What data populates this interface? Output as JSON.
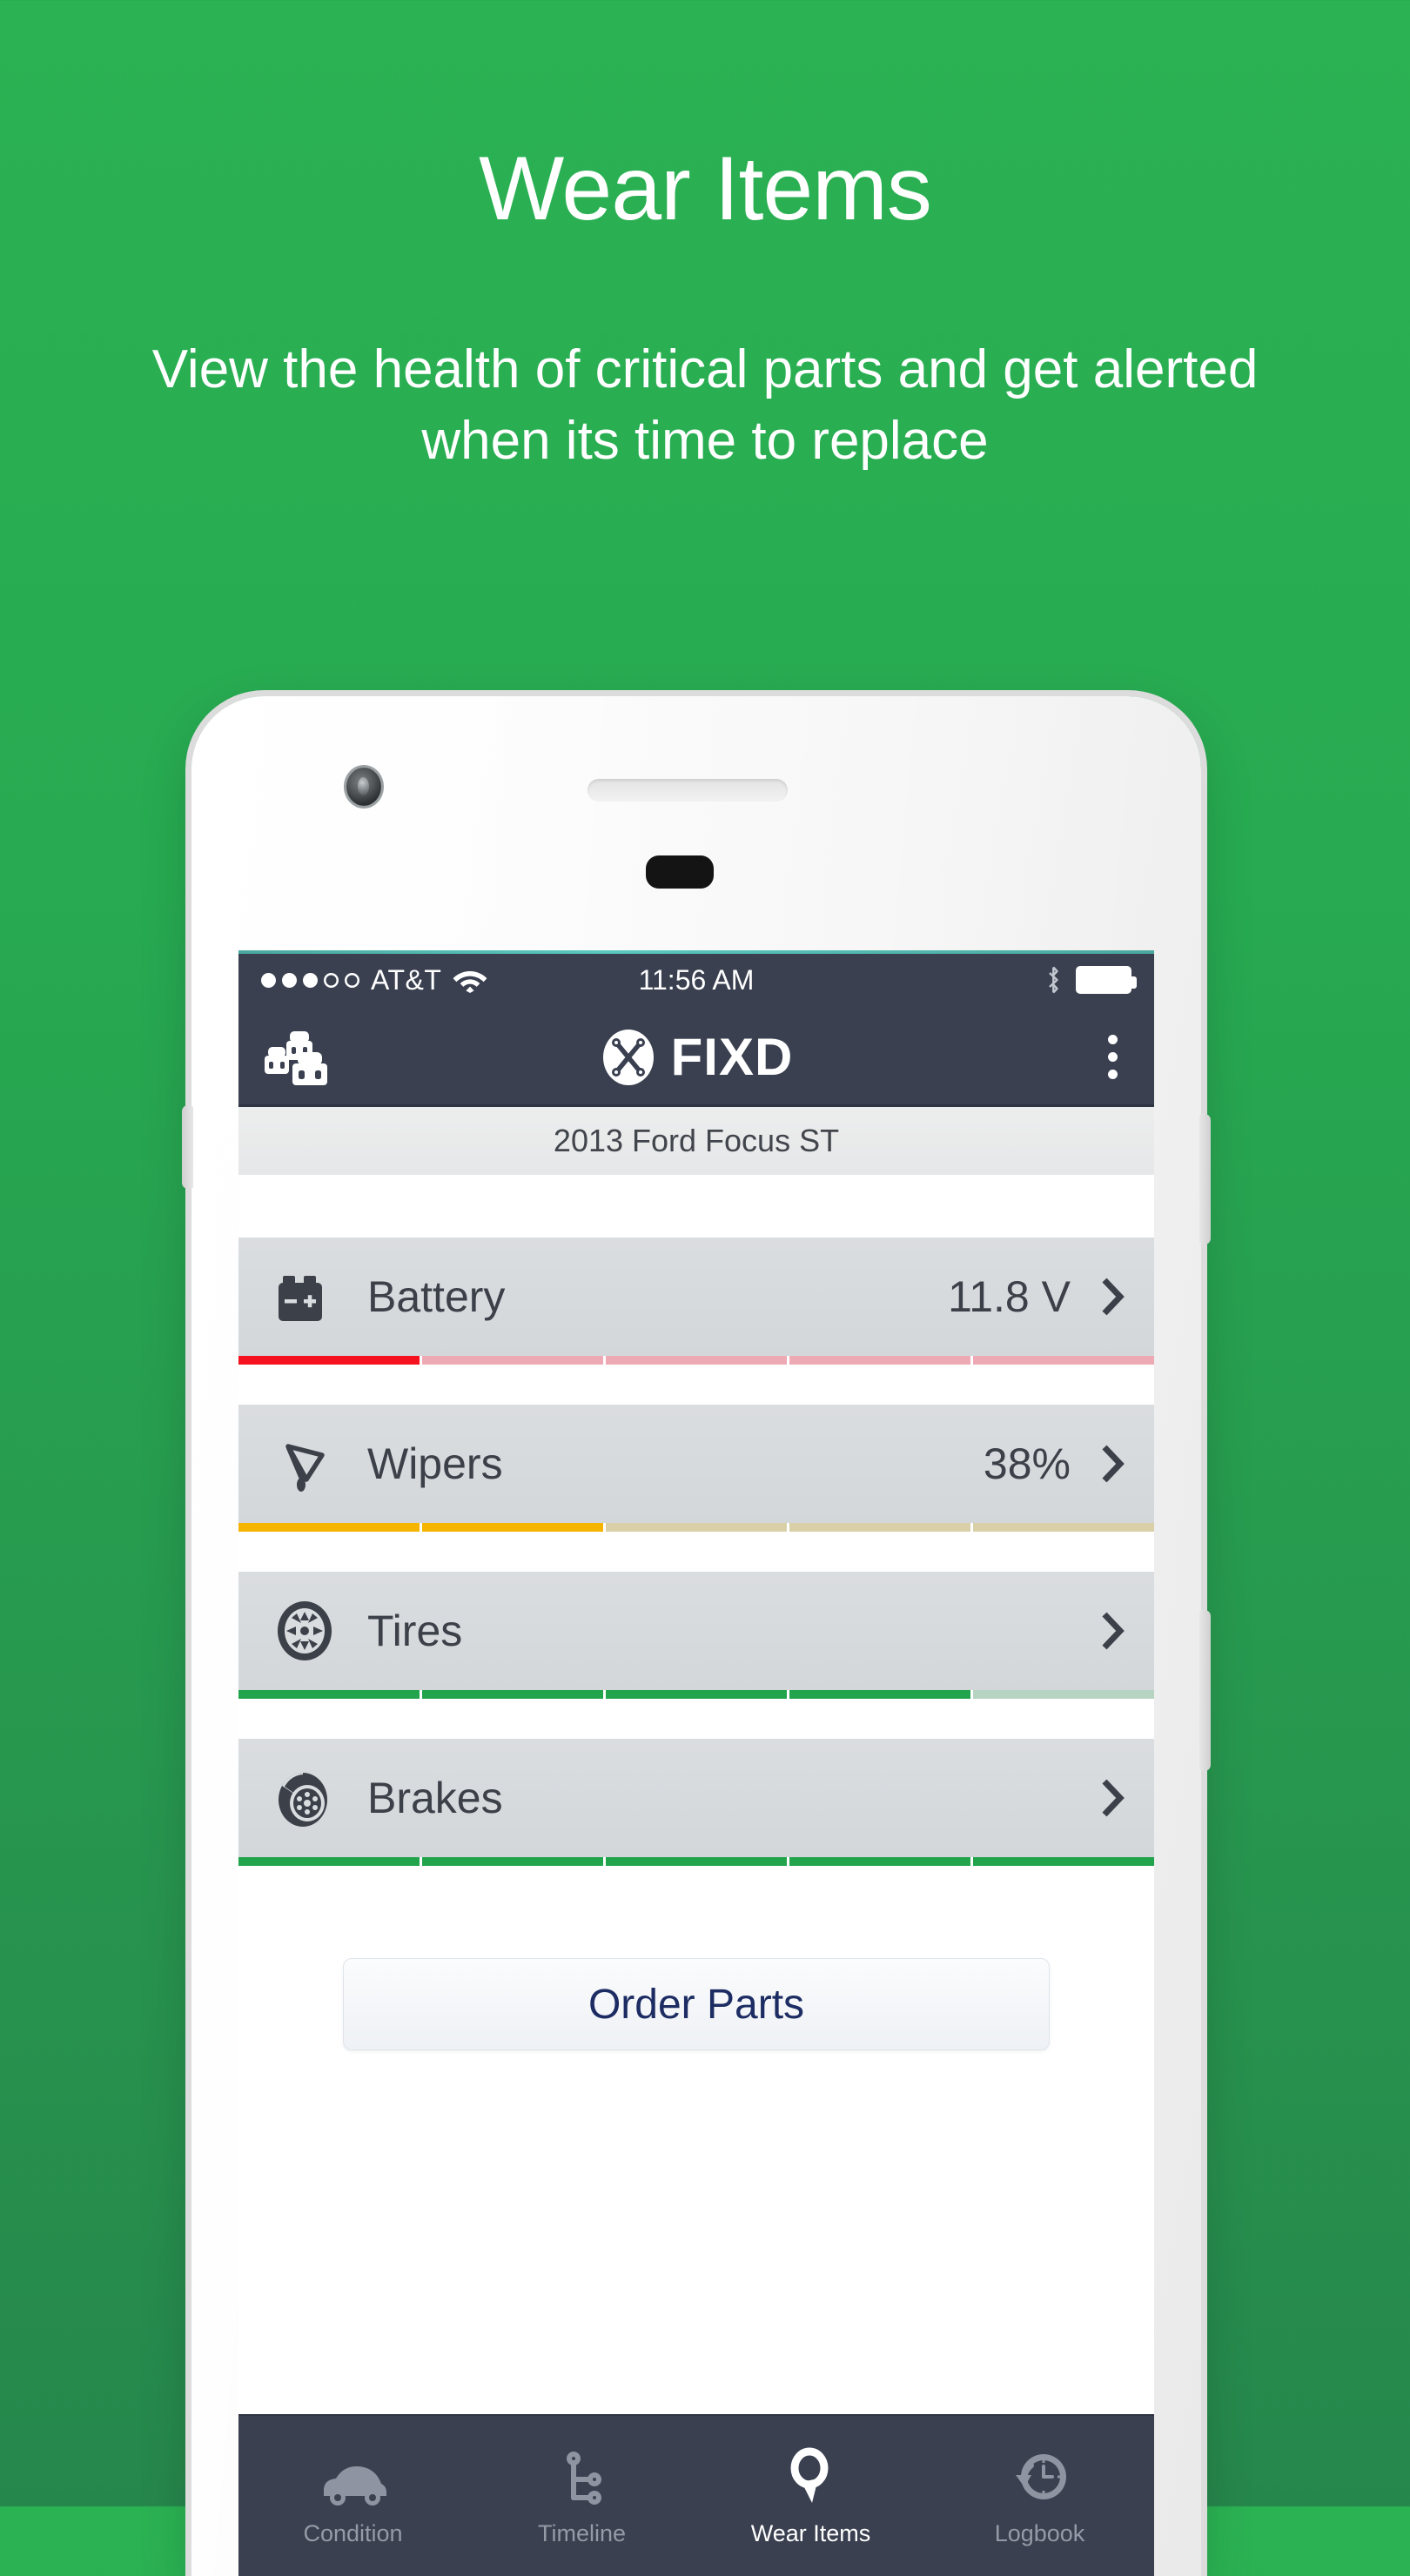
{
  "promo": {
    "title": "Wear Items",
    "subtitle": "View the health of critical parts and get alerted when its time to replace"
  },
  "colors": {
    "background_green_top": "#2bb253",
    "background_green_bottom": "#26874c",
    "header_navy": "#3a4050",
    "accent_red": "#f5121e",
    "accent_amber": "#f5b400",
    "accent_green": "#22a44c",
    "order_text_navy": "#1d2d63"
  },
  "status_bar": {
    "signal_icon": "signal-dots-icon",
    "signal_bars_filled": 3,
    "signal_bars_total": 5,
    "carrier": "AT&T",
    "wifi_icon": "wifi-icon",
    "time": "11:56 AM",
    "bluetooth_icon": "bluetooth-icon",
    "battery_icon": "battery-full-icon"
  },
  "app_bar": {
    "garage_icon": "cars-garage-icon",
    "brand_mark_icon": "fixd-wrench-logo-icon",
    "brand": "FIXD",
    "overflow_icon": "kebab-menu-icon"
  },
  "vehicle": {
    "name": "2013 Ford Focus ST"
  },
  "wear_items": [
    {
      "icon": "car-battery-icon",
      "label": "Battery",
      "value": "11.8 V",
      "chevron_icon": "chevron-right-icon",
      "meter_segments_total": 5,
      "meter_segments_filled": 1,
      "meter_fill_color": "#f5121e",
      "meter_track_color": "#eeaab4",
      "status": "critical"
    },
    {
      "icon": "windshield-wiper-icon",
      "label": "Wipers",
      "value": "38%",
      "chevron_icon": "chevron-right-icon",
      "meter_segments_total": 5,
      "meter_segments_filled": 2,
      "meter_fill_color": "#f5b400",
      "meter_track_color": "#d9d0a8",
      "status": "warning"
    },
    {
      "icon": "tire-wheel-icon",
      "label": "Tires",
      "value": "",
      "chevron_icon": "chevron-right-icon",
      "meter_segments_total": 5,
      "meter_segments_filled": 4,
      "meter_fill_color": "#22a44c",
      "meter_track_color": "#b6d4c1",
      "status": "good"
    },
    {
      "icon": "brake-rotor-icon",
      "label": "Brakes",
      "value": "",
      "chevron_icon": "chevron-right-icon",
      "meter_segments_total": 5,
      "meter_segments_filled": 5,
      "meter_fill_color": "#22a44c",
      "meter_track_color": "#b6d4c1",
      "status": "good"
    }
  ],
  "order_button": {
    "label": "Order Parts"
  },
  "tab_bar": {
    "tabs": [
      {
        "label": "Condition",
        "icon": "car-side-icon",
        "active": false
      },
      {
        "label": "Timeline",
        "icon": "branch-timeline-icon",
        "active": false
      },
      {
        "label": "Wear Items",
        "icon": "magnifier-search-icon",
        "active": true
      },
      {
        "label": "Logbook",
        "icon": "clock-history-icon",
        "active": false
      }
    ]
  }
}
